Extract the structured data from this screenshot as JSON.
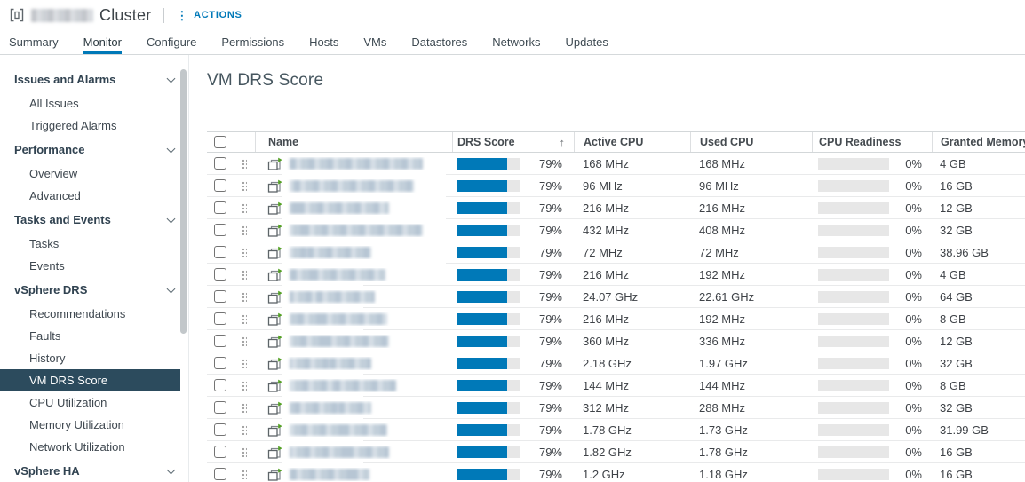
{
  "window": {
    "object_type_label": "Cluster",
    "object_name_redacted": true,
    "actions_label": "ACTIONS"
  },
  "icons": {
    "kebab": "⋮",
    "sort_ascending": "↑"
  },
  "tabs": {
    "items": [
      "Summary",
      "Monitor",
      "Configure",
      "Permissions",
      "Hosts",
      "VMs",
      "Datastores",
      "Networks",
      "Updates"
    ],
    "active": "Monitor"
  },
  "sidebar": {
    "sections": [
      {
        "label": "Issues and Alarms",
        "expanded": true,
        "items": [
          {
            "label": "All Issues"
          },
          {
            "label": "Triggered Alarms"
          }
        ]
      },
      {
        "label": "Performance",
        "expanded": true,
        "items": [
          {
            "label": "Overview"
          },
          {
            "label": "Advanced"
          }
        ]
      },
      {
        "label": "Tasks and Events",
        "expanded": true,
        "items": [
          {
            "label": "Tasks"
          },
          {
            "label": "Events"
          }
        ]
      },
      {
        "label": "vSphere DRS",
        "expanded": true,
        "items": [
          {
            "label": "Recommendations"
          },
          {
            "label": "Faults"
          },
          {
            "label": "History"
          },
          {
            "label": "VM DRS Score",
            "selected": true
          },
          {
            "label": "CPU Utilization"
          },
          {
            "label": "Memory Utilization"
          },
          {
            "label": "Network Utilization"
          }
        ]
      },
      {
        "label": "vSphere HA",
        "expanded": true,
        "items": []
      }
    ]
  },
  "main": {
    "title": "VM DRS Score",
    "table": {
      "columns": {
        "name": "Name",
        "drs_score": "DRS Score",
        "active_cpu": "Active CPU",
        "used_cpu": "Used CPU",
        "cpu_readiness": "CPU Readiness",
        "granted_memory": "Granted Memory"
      },
      "sort": {
        "column": "DRS Score",
        "direction": "ascending"
      },
      "rows": [
        {
          "name_redacted": true,
          "drs_score": "79%",
          "drs_score_value": 79,
          "active_cpu": "168 MHz",
          "used_cpu": "168 MHz",
          "cpu_readiness": "0%",
          "cpu_readiness_value": 0,
          "granted_memory": "4 GB"
        },
        {
          "name_redacted": true,
          "drs_score": "79%",
          "drs_score_value": 79,
          "active_cpu": "96 MHz",
          "used_cpu": "96 MHz",
          "cpu_readiness": "0%",
          "cpu_readiness_value": 0,
          "granted_memory": "16 GB"
        },
        {
          "name_redacted": true,
          "drs_score": "79%",
          "drs_score_value": 79,
          "active_cpu": "216 MHz",
          "used_cpu": "216 MHz",
          "cpu_readiness": "0%",
          "cpu_readiness_value": 0,
          "granted_memory": "12 GB"
        },
        {
          "name_redacted": true,
          "drs_score": "79%",
          "drs_score_value": 79,
          "active_cpu": "432 MHz",
          "used_cpu": "408 MHz",
          "cpu_readiness": "0%",
          "cpu_readiness_value": 0,
          "granted_memory": "32 GB"
        },
        {
          "name_redacted": true,
          "drs_score": "79%",
          "drs_score_value": 79,
          "active_cpu": "72 MHz",
          "used_cpu": "72 MHz",
          "cpu_readiness": "0%",
          "cpu_readiness_value": 0,
          "granted_memory": "38.96 GB"
        },
        {
          "name_redacted": true,
          "drs_score": "79%",
          "drs_score_value": 79,
          "active_cpu": "216 MHz",
          "used_cpu": "192 MHz",
          "cpu_readiness": "0%",
          "cpu_readiness_value": 0,
          "granted_memory": "4 GB"
        },
        {
          "name_redacted": true,
          "drs_score": "79%",
          "drs_score_value": 79,
          "active_cpu": "24.07 GHz",
          "used_cpu": "22.61 GHz",
          "cpu_readiness": "0%",
          "cpu_readiness_value": 0,
          "granted_memory": "64 GB"
        },
        {
          "name_redacted": true,
          "drs_score": "79%",
          "drs_score_value": 79,
          "active_cpu": "216 MHz",
          "used_cpu": "192 MHz",
          "cpu_readiness": "0%",
          "cpu_readiness_value": 0,
          "granted_memory": "8 GB"
        },
        {
          "name_redacted": true,
          "drs_score": "79%",
          "drs_score_value": 79,
          "active_cpu": "360 MHz",
          "used_cpu": "336 MHz",
          "cpu_readiness": "0%",
          "cpu_readiness_value": 0,
          "granted_memory": "12 GB"
        },
        {
          "name_redacted": true,
          "drs_score": "79%",
          "drs_score_value": 79,
          "active_cpu": "2.18 GHz",
          "used_cpu": "1.97 GHz",
          "cpu_readiness": "0%",
          "cpu_readiness_value": 0,
          "granted_memory": "32 GB"
        },
        {
          "name_redacted": true,
          "drs_score": "79%",
          "drs_score_value": 79,
          "active_cpu": "144 MHz",
          "used_cpu": "144 MHz",
          "cpu_readiness": "0%",
          "cpu_readiness_value": 0,
          "granted_memory": "8 GB"
        },
        {
          "name_redacted": true,
          "drs_score": "79%",
          "drs_score_value": 79,
          "active_cpu": "312 MHz",
          "used_cpu": "288 MHz",
          "cpu_readiness": "0%",
          "cpu_readiness_value": 0,
          "granted_memory": "32 GB"
        },
        {
          "name_redacted": true,
          "drs_score": "79%",
          "drs_score_value": 79,
          "active_cpu": "1.78 GHz",
          "used_cpu": "1.73 GHz",
          "cpu_readiness": "0%",
          "cpu_readiness_value": 0,
          "granted_memory": "31.99 GB"
        },
        {
          "name_redacted": true,
          "drs_score": "79%",
          "drs_score_value": 79,
          "active_cpu": "1.82 GHz",
          "used_cpu": "1.78 GHz",
          "cpu_readiness": "0%",
          "cpu_readiness_value": 0,
          "granted_memory": "16 GB"
        },
        {
          "name_redacted": true,
          "drs_score": "79%",
          "drs_score_value": 79,
          "active_cpu": "1.2 GHz",
          "used_cpu": "1.18 GHz",
          "cpu_readiness": "0%",
          "cpu_readiness_value": 0,
          "granted_memory": "16 GB"
        }
      ]
    }
  },
  "colors": {
    "accent": "#0079B8",
    "selected_nav_bg": "#2C4B5D",
    "drs_bar_fill": "#0079B8",
    "bar_track": "#E7E7E7",
    "powered_on_green": "#54A124"
  }
}
